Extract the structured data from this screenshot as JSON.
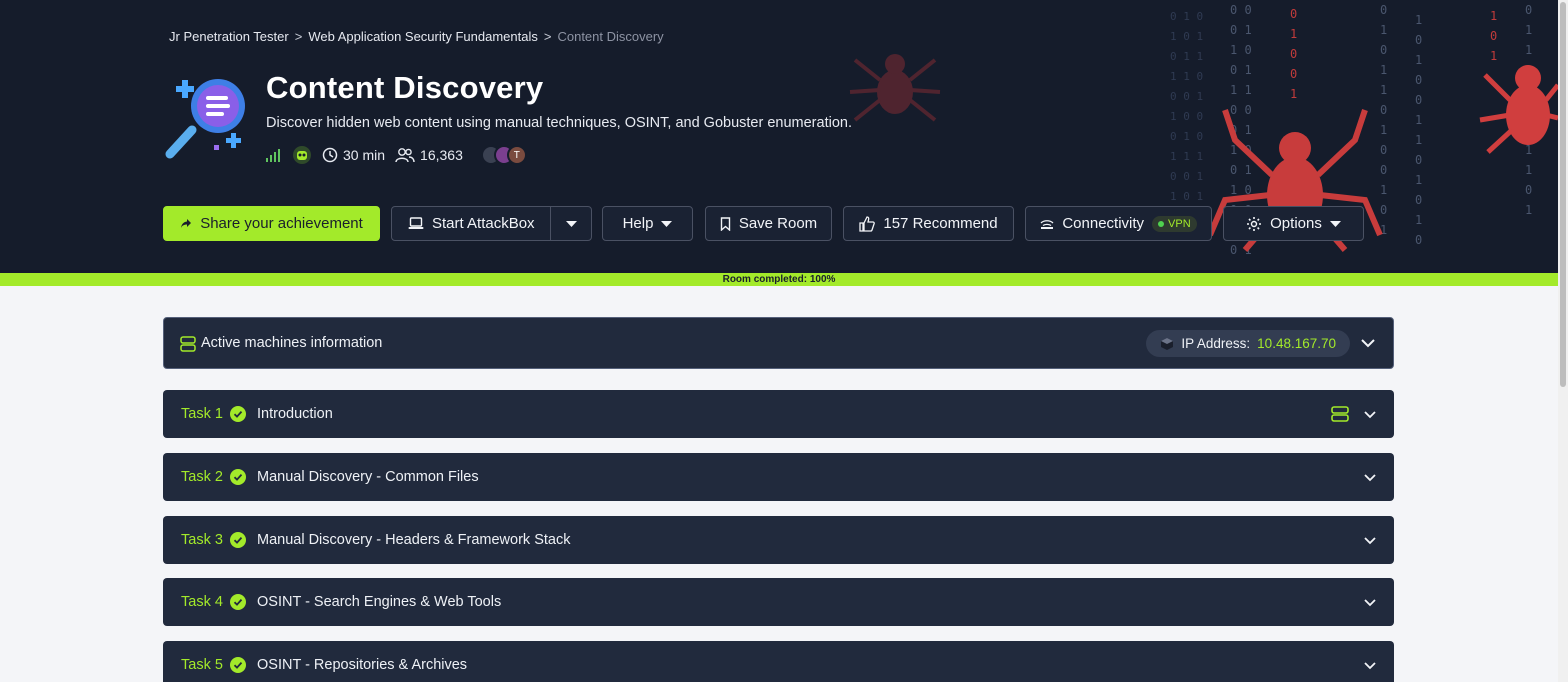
{
  "breadcrumb": {
    "items": [
      "Jr Penetration Tester",
      "Web Application Security Fundamentals"
    ],
    "current": "Content Discovery",
    "separator": ">"
  },
  "room": {
    "title": "Content Discovery",
    "description": "Discover hidden web content using manual techniques, OSINT, and Gobuster enumeration.",
    "duration": "30 min",
    "users": "16,363",
    "difficulty_icon": "signal-bars-icon",
    "avatar_initial": "T"
  },
  "actions": {
    "share": "Share your achievement",
    "attackbox": "Start AttackBox",
    "help": "Help",
    "save": "Save Room",
    "recommend": "157 Recommend",
    "connectivity": "Connectivity",
    "vpn": "VPN",
    "options": "Options"
  },
  "progress": {
    "label": "Room completed: 100%",
    "percent": 100
  },
  "machines": {
    "label": "Active machines information",
    "ip_label": "IP Address:",
    "ip": "10.48.167.70"
  },
  "tasks": [
    {
      "num": "Task 1",
      "title": "Introduction",
      "has_machine": true
    },
    {
      "num": "Task 2",
      "title": "Manual Discovery - Common Files",
      "has_machine": false
    },
    {
      "num": "Task 3",
      "title": "Manual Discovery - Headers & Framework Stack",
      "has_machine": false
    },
    {
      "num": "Task 4",
      "title": "OSINT - Search Engines & Web Tools",
      "has_machine": false
    },
    {
      "num": "Task 5",
      "title": "OSINT - Repositories & Archives",
      "has_machine": false
    }
  ],
  "colors": {
    "accent": "#a3ea2a",
    "hero_bg": "#151c2b",
    "panel_bg": "#212a3d",
    "page_bg": "#f4f5f8"
  }
}
